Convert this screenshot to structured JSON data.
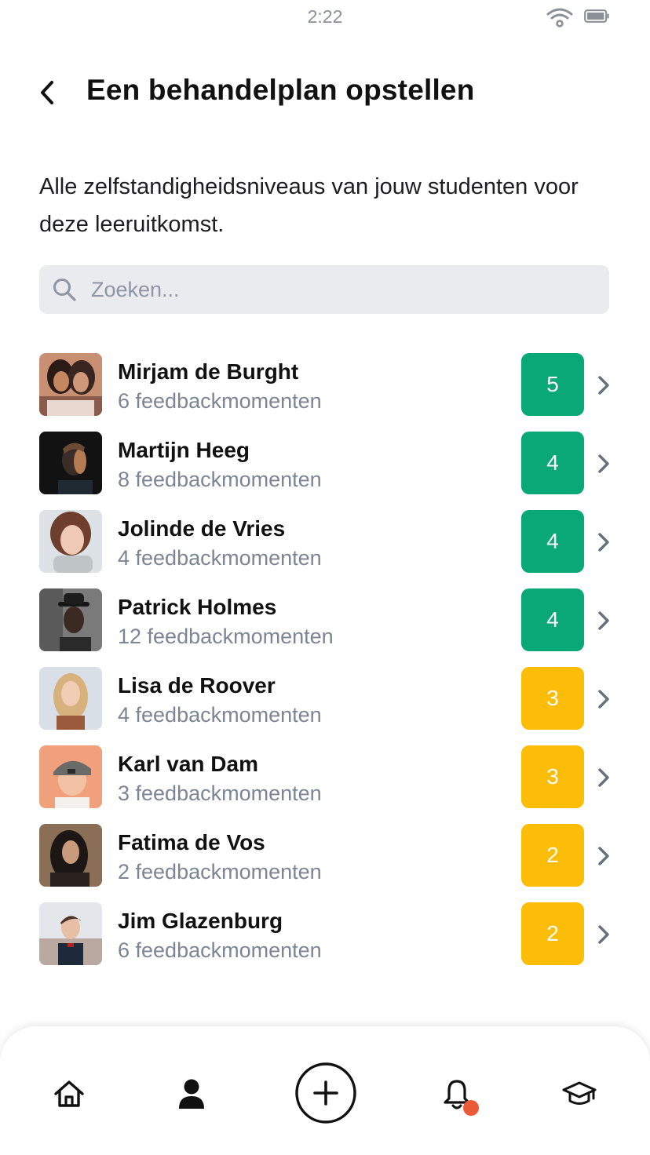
{
  "status_bar": {
    "time": "2:22"
  },
  "header": {
    "title": "Een behandelplan opstellen"
  },
  "intro": "Alle zelfstandigheidsniveaus van jouw studenten voor deze leeruitkomst.",
  "search": {
    "placeholder": "Zoeken..."
  },
  "colors": {
    "green": "#0aa876",
    "yellow": "#fbbd08",
    "notification": "#ec5b35"
  },
  "students": [
    {
      "name": "Mirjam de Burght",
      "moments": "6 feedbackmomenten",
      "level": "5",
      "color": "green"
    },
    {
      "name": "Martijn Heeg",
      "moments": "8 feedbackmomenten",
      "level": "4",
      "color": "green"
    },
    {
      "name": "Jolinde de Vries",
      "moments": "4 feedbackmomenten",
      "level": "4",
      "color": "green"
    },
    {
      "name": "Patrick Holmes",
      "moments": "12 feedbackmomenten",
      "level": "4",
      "color": "green"
    },
    {
      "name": "Lisa de Roover",
      "moments": "4 feedbackmomenten",
      "level": "3",
      "color": "yellow"
    },
    {
      "name": "Karl van Dam",
      "moments": "3 feedbackmomenten",
      "level": "3",
      "color": "yellow"
    },
    {
      "name": "Fatima de Vos",
      "moments": "2 feedbackmomenten",
      "level": "2",
      "color": "yellow"
    },
    {
      "name": "Jim Glazenburg",
      "moments": "6 feedbackmomenten",
      "level": "2",
      "color": "yellow"
    }
  ],
  "tabbar": {
    "icons": [
      "home-icon",
      "person-icon",
      "plus-circle-icon",
      "bell-icon",
      "graduation-cap-icon"
    ],
    "notification": true
  }
}
